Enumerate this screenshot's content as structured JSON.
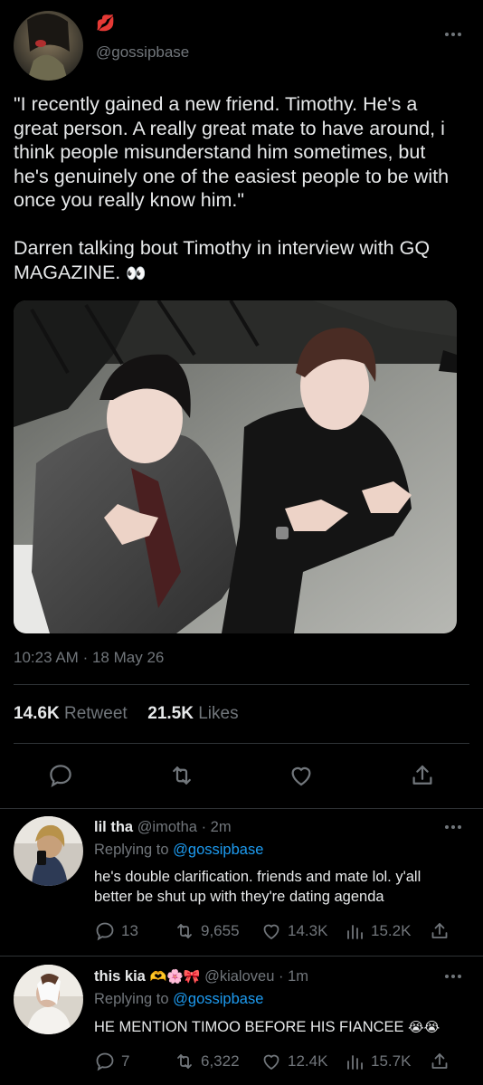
{
  "tweet": {
    "handle": "@gossipbase",
    "lips_emoji": "💋",
    "text_line1": "\"I recently gained a new friend. Timothy. He's a",
    "text_line2": "great person. A really great mate to have around, i",
    "text_line3": "think people misunderstand him sometimes, but",
    "text_line4": "he's genuinely one of the easiest people to be with",
    "text_line5": "once you really know him.\"",
    "text_line6": "Darren talking bout Timothy in interview with GQ",
    "text_line7": "MAGAZINE.",
    "eyes_emoji": "👀",
    "time": "10:23 AM",
    "dot": "·",
    "date": "18 May 26",
    "retweets_count": "14.6K",
    "retweets_label": "Retweet",
    "likes_count": "21.5K",
    "likes_label": "Likes"
  },
  "replies": [
    {
      "name": "lil tha",
      "handle": "@imotha",
      "dot": "·",
      "age": "2m",
      "replying_label": "Replying to",
      "replying_to": "@gossipbase",
      "text_line1": "he's double clarification. friends and mate lol. y'all",
      "text_line2": "better be shut up with they're dating agenda",
      "replies": "13",
      "retweets": "9,655",
      "likes": "14.3K",
      "views": "15.2K"
    },
    {
      "name": "this kia",
      "name_emojis": "🫶🌸🎀",
      "handle": "@kialoveu",
      "dot": "·",
      "age": "1m",
      "replying_label": "Replying to",
      "replying_to": "@gossipbase",
      "text_line1": "HE MENTION TIMOO BEFORE HIS FIANCEE",
      "text_emojis": "😭😭",
      "replies": "7",
      "retweets": "6,322",
      "likes": "12.4K",
      "views": "15.7K"
    }
  ],
  "icons": {
    "reply": "reply-icon",
    "retweet": "retweet-icon",
    "like": "heart-icon",
    "share": "share-icon",
    "views": "views-icon",
    "more": "more-icon"
  }
}
